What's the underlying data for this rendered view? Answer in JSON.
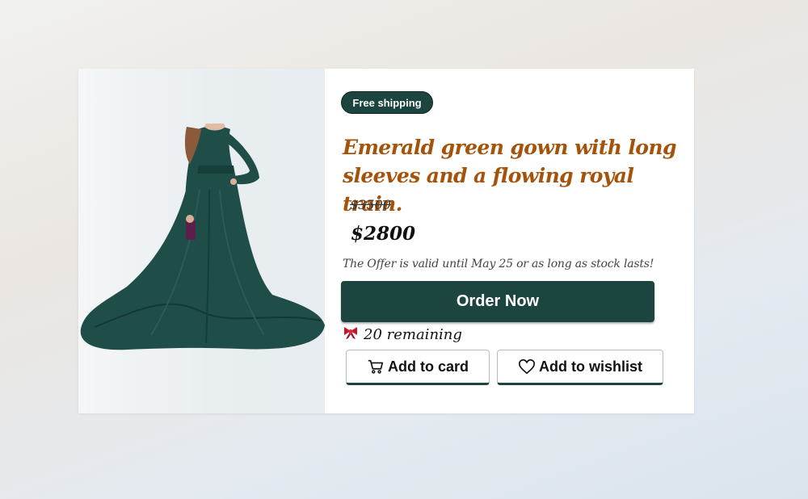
{
  "product": {
    "badge": "Free shipping",
    "title": "Emerald green gown with long sleeves and a flowing royal train.",
    "old_price": "$3500",
    "new_price": "$2800",
    "offer_text": "The Offer is valid until May 25 or as long as stock lasts!",
    "remaining": "20 remaining",
    "image_alt": "Emerald green gown"
  },
  "actions": {
    "order_label": "Order Now",
    "cart_label": "Add to card",
    "wishlist_label": "Add to wishlist"
  },
  "icons": {
    "remaining_icon": "ribbon-icon",
    "cart_icon": "cart-icon",
    "wishlist_icon": "heart-icon"
  },
  "colors": {
    "accent": "#1c4540",
    "title": "#a5530a"
  }
}
